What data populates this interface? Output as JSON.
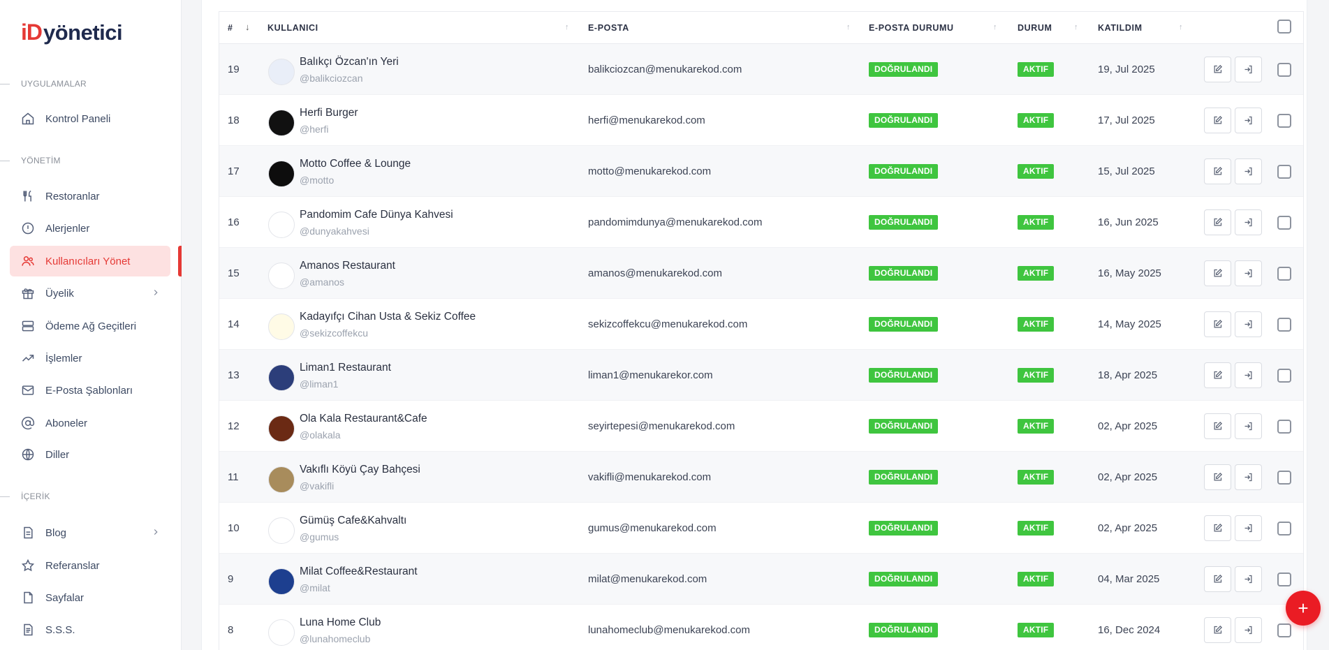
{
  "logo": {
    "prefix": "iD",
    "text": "yönetici"
  },
  "sidebar": {
    "sections": [
      {
        "label": "UYGULAMALAR"
      },
      {
        "label": "YÖNETİM"
      },
      {
        "label": "İÇERİK"
      }
    ],
    "items": [
      {
        "label": "Kontrol Paneli",
        "icon": "home-icon"
      },
      {
        "label": "Restoranlar",
        "icon": "utensils-icon"
      },
      {
        "label": "Alerjenler",
        "icon": "alert-circle-icon"
      },
      {
        "label": "Kullanıcıları Yönet",
        "icon": "users-icon",
        "active": true
      },
      {
        "label": "Üyelik",
        "icon": "gift-icon",
        "has_children": true
      },
      {
        "label": "Ödeme Ağ Geçitleri",
        "icon": "server-icon"
      },
      {
        "label": "İşlemler",
        "icon": "trending-up-icon"
      },
      {
        "label": "E-Posta Şablonları",
        "icon": "mail-icon"
      },
      {
        "label": "Aboneler",
        "icon": "at-sign-icon"
      },
      {
        "label": "Diller",
        "icon": "globe-icon"
      },
      {
        "label": "Blog",
        "icon": "file-text-icon",
        "has_children": true
      },
      {
        "label": "Referanslar",
        "icon": "star-icon"
      },
      {
        "label": "Sayfalar",
        "icon": "file-icon"
      },
      {
        "label": "S.S.S.",
        "icon": "document-icon"
      }
    ]
  },
  "table": {
    "columns": {
      "num": "#",
      "user": "KULLANICI",
      "email": "E-POSTA",
      "email_status": "E-POSTA DURUMU",
      "status": "DURUM",
      "joined": "KATILDIM"
    },
    "rows": [
      {
        "id": "19",
        "name": "Balıkçı Özcan'ın Yeri",
        "handle": "@balikciozcan",
        "email": "balikciozcan@menukarekod.com",
        "email_status": "DOĞRULANDI",
        "status": "AKTIF",
        "joined": "19, Jul 2025",
        "avatar_color": "#e9eef8",
        "avatar_fg": "#1b4da3"
      },
      {
        "id": "18",
        "name": "Herfi Burger",
        "handle": "@herfi",
        "email": "herfi@menukarekod.com",
        "email_status": "DOĞRULANDI",
        "status": "AKTIF",
        "joined": "17, Jul 2025",
        "avatar_color": "#111111",
        "avatar_fg": "#ffffff"
      },
      {
        "id": "17",
        "name": "Motto Coffee & Lounge",
        "handle": "@motto",
        "email": "motto@menukarekod.com",
        "email_status": "DOĞRULANDI",
        "status": "AKTIF",
        "joined": "15, Jul 2025",
        "avatar_color": "#0d0d0d",
        "avatar_fg": "#c9c9c9"
      },
      {
        "id": "16",
        "name": "Pandomim Cafe Dünya Kahvesi",
        "handle": "@dunyakahvesi",
        "email": "pandomimdunya@menukarekod.com",
        "email_status": "DOĞRULANDI",
        "status": "AKTIF",
        "joined": "16, Jun 2025",
        "avatar_color": "#ffffff",
        "avatar_fg": "#c62828"
      },
      {
        "id": "15",
        "name": "Amanos Restaurant",
        "handle": "@amanos",
        "email": "amanos@menukarekod.com",
        "email_status": "DOĞRULANDI",
        "status": "AKTIF",
        "joined": "16, May 2025",
        "avatar_color": "#ffffff",
        "avatar_fg": "#d32f2f"
      },
      {
        "id": "14",
        "name": "Kadayıfçı Cihan Usta & Sekiz Coffee",
        "handle": "@sekizcoffekcu",
        "email": "sekizcoffekcu@menukarekod.com",
        "email_status": "DOĞRULANDI",
        "status": "AKTIF",
        "joined": "14, May 2025",
        "avatar_color": "#fffbe6",
        "avatar_fg": "#c9a400"
      },
      {
        "id": "13",
        "name": "Liman1 Restaurant",
        "handle": "@liman1",
        "email": "liman1@menukarekor.com",
        "email_status": "DOĞRULANDI",
        "status": "AKTIF",
        "joined": "18, Apr 2025",
        "avatar_color": "#2c3e7a",
        "avatar_fg": "#ffffff"
      },
      {
        "id": "12",
        "name": "Ola Kala Restaurant&Cafe",
        "handle": "@olakala",
        "email": "seyirtepesi@menukarekod.com",
        "email_status": "DOĞRULANDI",
        "status": "AKTIF",
        "joined": "02, Apr 2025",
        "avatar_color": "#6b2a14",
        "avatar_fg": "#f4d9a8"
      },
      {
        "id": "11",
        "name": "Vakıflı Köyü Çay Bahçesi",
        "handle": "@vakifli",
        "email": "vakifli@menukarekod.com",
        "email_status": "DOĞRULANDI",
        "status": "AKTIF",
        "joined": "02, Apr 2025",
        "avatar_color": "#a88c5c",
        "avatar_fg": "#ffffff"
      },
      {
        "id": "10",
        "name": "Gümüş Cafe&Kahvaltı",
        "handle": "@gumus",
        "email": "gumus@menukarekod.com",
        "email_status": "DOĞRULANDI",
        "status": "AKTIF",
        "joined": "02, Apr 2025",
        "avatar_color": "#ffffff",
        "avatar_fg": "#8a1f1f"
      },
      {
        "id": "9",
        "name": "Milat Coffee&Restaurant",
        "handle": "@milat",
        "email": "milat@menukarekod.com",
        "email_status": "DOĞRULANDI",
        "status": "AKTIF",
        "joined": "04, Mar 2025",
        "avatar_color": "#1d3f8f",
        "avatar_fg": "#7ed957"
      },
      {
        "id": "8",
        "name": "Luna Home Club",
        "handle": "@lunahomeclub",
        "email": "lunahomeclub@menukarekod.com",
        "email_status": "DOĞRULANDI",
        "status": "AKTIF",
        "joined": "16, Dec 2024",
        "avatar_color": "#ffffff",
        "avatar_fg": "#c62828"
      }
    ]
  },
  "fab": {
    "label": "+"
  },
  "colors": {
    "brand": "#e53935",
    "success": "#3fc53f",
    "navy": "#1f2a4d"
  }
}
